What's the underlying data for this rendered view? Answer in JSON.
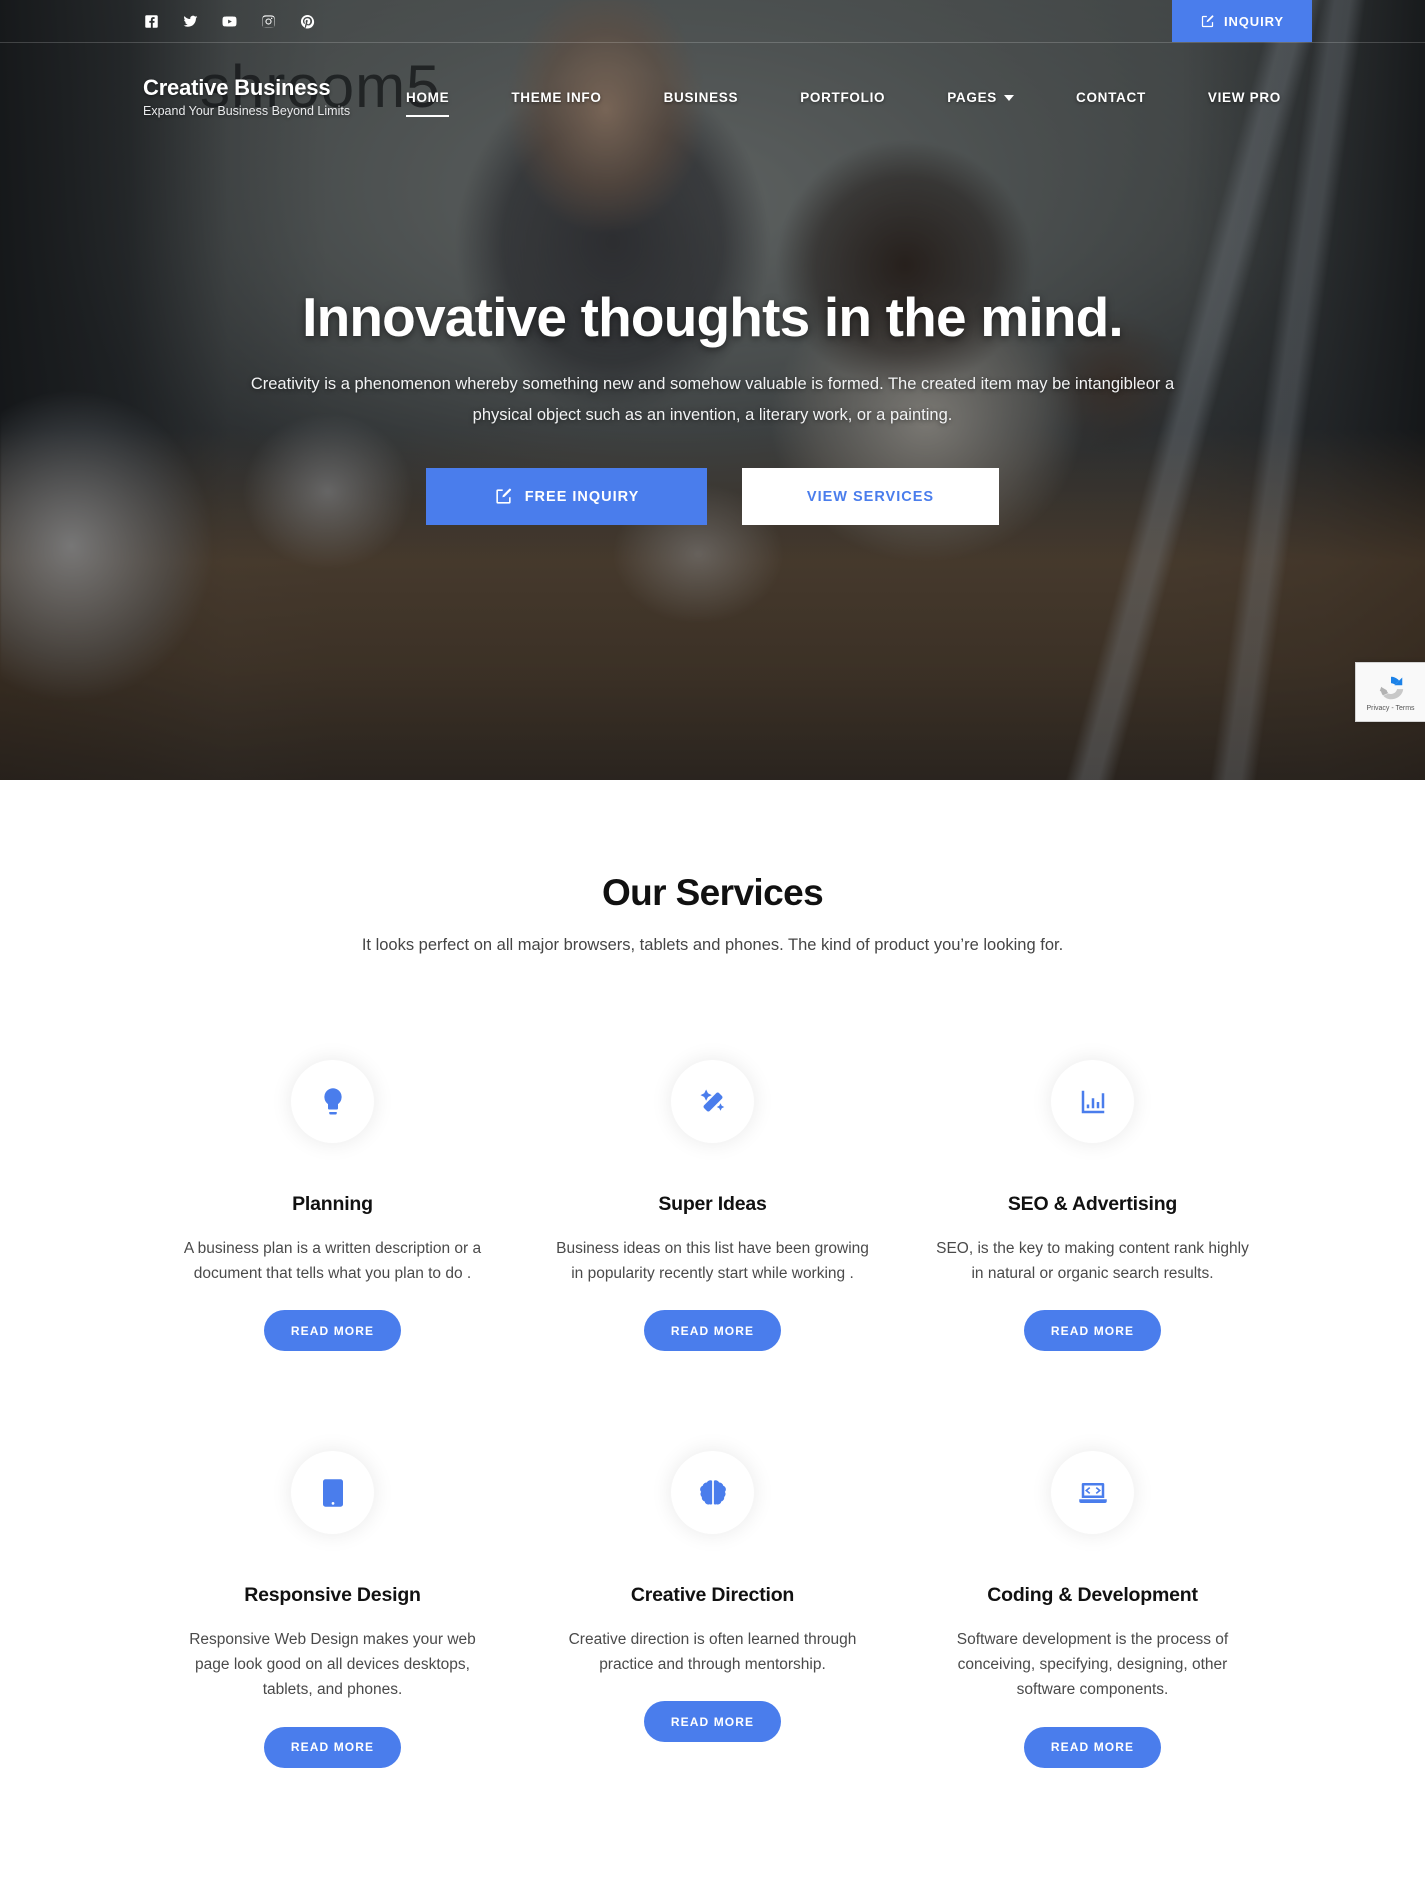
{
  "theme": {
    "accent": "#4a7dec",
    "hero_text": "#ffffff",
    "body_text": "#4a4a4a"
  },
  "topbar": {
    "social": [
      {
        "name": "facebook",
        "label": "Facebook"
      },
      {
        "name": "twitter",
        "label": "Twitter"
      },
      {
        "name": "youtube",
        "label": "YouTube"
      },
      {
        "name": "instagram",
        "label": "Instagram"
      },
      {
        "name": "pinterest",
        "label": "Pinterest"
      }
    ],
    "inquiry_label": "INQUIRY"
  },
  "brand": {
    "title": "Creative Business",
    "tagline": "Expand Your Business Beyond Limits"
  },
  "nav": {
    "items": [
      {
        "label": "HOME",
        "active": true,
        "dropdown": false
      },
      {
        "label": "THEME INFO",
        "active": false,
        "dropdown": false
      },
      {
        "label": "BUSINESS",
        "active": false,
        "dropdown": false
      },
      {
        "label": "PORTFOLIO",
        "active": false,
        "dropdown": false
      },
      {
        "label": "PAGES",
        "active": false,
        "dropdown": true
      },
      {
        "label": "CONTACT",
        "active": false,
        "dropdown": false
      },
      {
        "label": "VIEW PRO",
        "active": false,
        "dropdown": false
      }
    ]
  },
  "hero": {
    "wall_text": "shroom5",
    "title": "Innovative thoughts in the mind.",
    "subtitle": "Creativity is a phenomenon whereby something new and somehow valuable is formed. The created item may be intangibleor a physical object such as an invention, a literary work, or a painting.",
    "primary_cta": "FREE INQUIRY",
    "secondary_cta": "VIEW SERVICES"
  },
  "recaptcha": {
    "text": "Privacy - Terms"
  },
  "services": {
    "title": "Our Services",
    "subtitle": "It looks perfect on all major browsers, tablets and phones. The kind of product you’re looking for.",
    "read_more_label": "READ MORE",
    "items": [
      {
        "icon": "lightbulb-icon",
        "title": "Planning",
        "desc": "A business plan is a written description or a document that tells what you plan to do .",
        "button": "READ MORE"
      },
      {
        "icon": "magic-wand-icon",
        "title": "Super Ideas",
        "desc": "Business ideas on this list have been growing in popularity recently start while working .",
        "button": "READ MORE"
      },
      {
        "icon": "bar-chart-icon",
        "title": "SEO & Advertising",
        "desc": "SEO, is the key to making content rank highly in natural or organic search results.",
        "button": "READ MORE"
      },
      {
        "icon": "tablet-icon",
        "title": "Responsive Design",
        "desc": "Responsive Web Design makes your web page look good on all devices desktops, tablets, and phones.",
        "button": "READ MORE"
      },
      {
        "icon": "brain-icon",
        "title": "Creative Direction",
        "desc": "Creative direction is often learned through practice and through mentorship.",
        "button": "READ MORE"
      },
      {
        "icon": "laptop-code-icon",
        "title": "Coding & Development",
        "desc": "Software development is the process of conceiving, specifying, designing, other software components.",
        "button": "READ MORE"
      }
    ]
  }
}
